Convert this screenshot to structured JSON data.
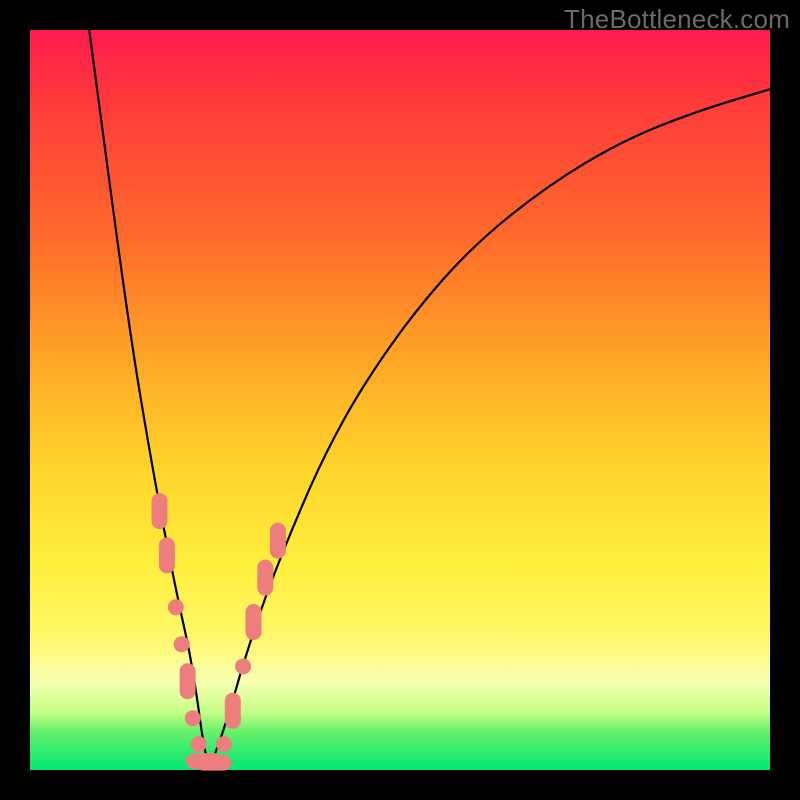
{
  "watermark_text": "TheBottleneck.com",
  "colors": {
    "frame": "#000000",
    "marker": "#ee7d7d",
    "curve": "#000000",
    "gradient_stops": [
      {
        "pct": 0,
        "hex": "#ff1a4d"
      },
      {
        "pct": 10,
        "hex": "#ff3b3b"
      },
      {
        "pct": 28,
        "hex": "#ff6a2a"
      },
      {
        "pct": 45,
        "hex": "#ffa826"
      },
      {
        "pct": 60,
        "hex": "#ffd62b"
      },
      {
        "pct": 72,
        "hex": "#ffee3c"
      },
      {
        "pct": 82,
        "hex": "#fff86a"
      },
      {
        "pct": 88,
        "hex": "#f8ffb0"
      },
      {
        "pct": 92,
        "hex": "#c8ff8a"
      },
      {
        "pct": 95,
        "hex": "#63f06a"
      },
      {
        "pct": 100,
        "hex": "#00e873"
      }
    ]
  },
  "chart_data": {
    "type": "line",
    "title": "",
    "xlabel": "",
    "ylabel": "",
    "xlim": [
      0,
      100
    ],
    "ylim": [
      0,
      100
    ],
    "annotations": [
      {
        "text": "TheBottleneck.com",
        "position": "top-right"
      }
    ],
    "series": [
      {
        "name": "bottleneck-curve",
        "x": [
          8,
          10,
          12,
          14,
          16,
          18,
          20,
          22,
          23.9,
          25,
          27,
          29,
          32,
          36,
          40,
          45,
          52,
          60,
          70,
          80,
          90,
          100
        ],
        "y": [
          100,
          85,
          70,
          56,
          44,
          33,
          23,
          14,
          0,
          2,
          8,
          15,
          24,
          34,
          43,
          52,
          62,
          71,
          79,
          85,
          89,
          92
        ]
      }
    ],
    "markers": [
      {
        "series": "bottleneck-curve",
        "x": 17.5,
        "y": 35,
        "shape": "capsule-v"
      },
      {
        "series": "bottleneck-curve",
        "x": 18.5,
        "y": 29,
        "shape": "capsule-v"
      },
      {
        "series": "bottleneck-curve",
        "x": 19.7,
        "y": 22,
        "shape": "circle"
      },
      {
        "series": "bottleneck-curve",
        "x": 20.5,
        "y": 17,
        "shape": "circle"
      },
      {
        "series": "bottleneck-curve",
        "x": 21.3,
        "y": 12,
        "shape": "capsule-v"
      },
      {
        "series": "bottleneck-curve",
        "x": 22.0,
        "y": 7,
        "shape": "circle"
      },
      {
        "series": "bottleneck-curve",
        "x": 22.8,
        "y": 3.5,
        "shape": "circle"
      },
      {
        "series": "bottleneck-curve",
        "x": 23.5,
        "y": 1.2,
        "shape": "capsule-h"
      },
      {
        "series": "bottleneck-curve",
        "x": 24.8,
        "y": 1.0,
        "shape": "capsule-h"
      },
      {
        "series": "bottleneck-curve",
        "x": 26.2,
        "y": 3.5,
        "shape": "circle"
      },
      {
        "series": "bottleneck-curve",
        "x": 27.4,
        "y": 8,
        "shape": "capsule-v"
      },
      {
        "series": "bottleneck-curve",
        "x": 28.8,
        "y": 14,
        "shape": "circle"
      },
      {
        "series": "bottleneck-curve",
        "x": 30.2,
        "y": 20,
        "shape": "capsule-v"
      },
      {
        "series": "bottleneck-curve",
        "x": 31.8,
        "y": 26,
        "shape": "capsule-v"
      },
      {
        "series": "bottleneck-curve",
        "x": 33.5,
        "y": 31,
        "shape": "capsule-v"
      }
    ],
    "valley_x": 23.9,
    "background_gradient": "red-yellow-green vertical (severity heatmap)"
  }
}
